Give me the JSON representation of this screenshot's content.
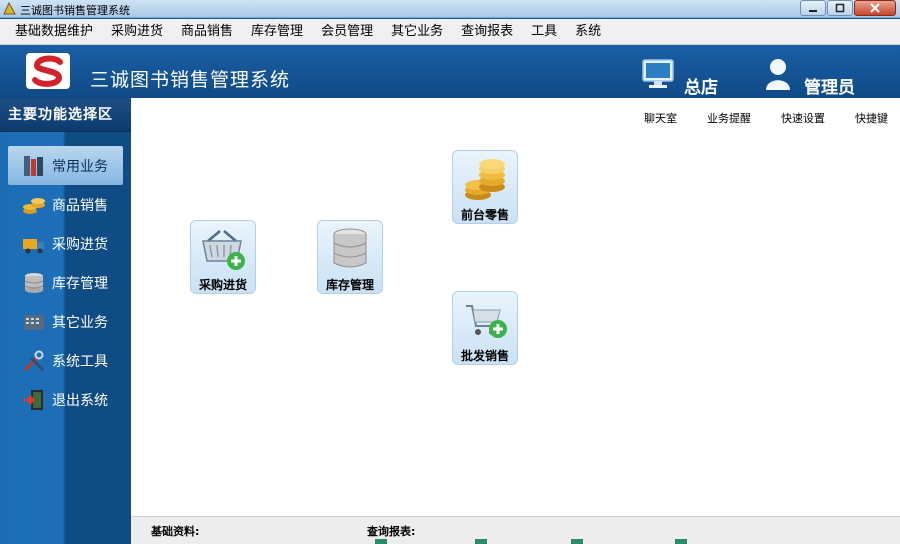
{
  "window": {
    "title": "三诚图书销售管理系统"
  },
  "menubar": {
    "items": [
      "基础数据维护",
      "采购进货",
      "商品销售",
      "库存管理",
      "会员管理",
      "其它业务",
      "查询报表",
      "工具",
      "系统"
    ]
  },
  "header": {
    "app_title": "三诚图书销售管理系统",
    "store_label": "总店",
    "user_label": "管理员"
  },
  "sidebar": {
    "title": "主要功能选择区",
    "items": [
      {
        "label": "常用业务",
        "icon": "bookshelf-icon",
        "active": true
      },
      {
        "label": "商品销售",
        "icon": "coins-icon",
        "active": false
      },
      {
        "label": "采购进货",
        "icon": "truck-icon",
        "active": false
      },
      {
        "label": "库存管理",
        "icon": "database-icon",
        "active": false
      },
      {
        "label": "其它业务",
        "icon": "cash-register-icon",
        "active": false
      },
      {
        "label": "系统工具",
        "icon": "tools-icon",
        "active": false
      },
      {
        "label": "退出系统",
        "icon": "exit-door-icon",
        "active": false
      }
    ]
  },
  "quick_links": [
    "聊天室",
    "业务提醒",
    "快速设置",
    "快捷键"
  ],
  "tiles": {
    "retail": {
      "label": "前台零售",
      "icon": "coins-icon"
    },
    "purchase": {
      "label": "采购进货",
      "icon": "basket-add-icon"
    },
    "inventory": {
      "label": "库存管理",
      "icon": "database-icon"
    },
    "wholesale": {
      "label": "批发销售",
      "icon": "cart-add-icon"
    }
  },
  "bottom": {
    "basic_label": "基础资料:",
    "report_label": "查询报表:"
  },
  "colors": {
    "header_blue": "#0f4a86",
    "sidebar_blue": "#1c6db4",
    "accent_green": "#2b8a6a"
  }
}
